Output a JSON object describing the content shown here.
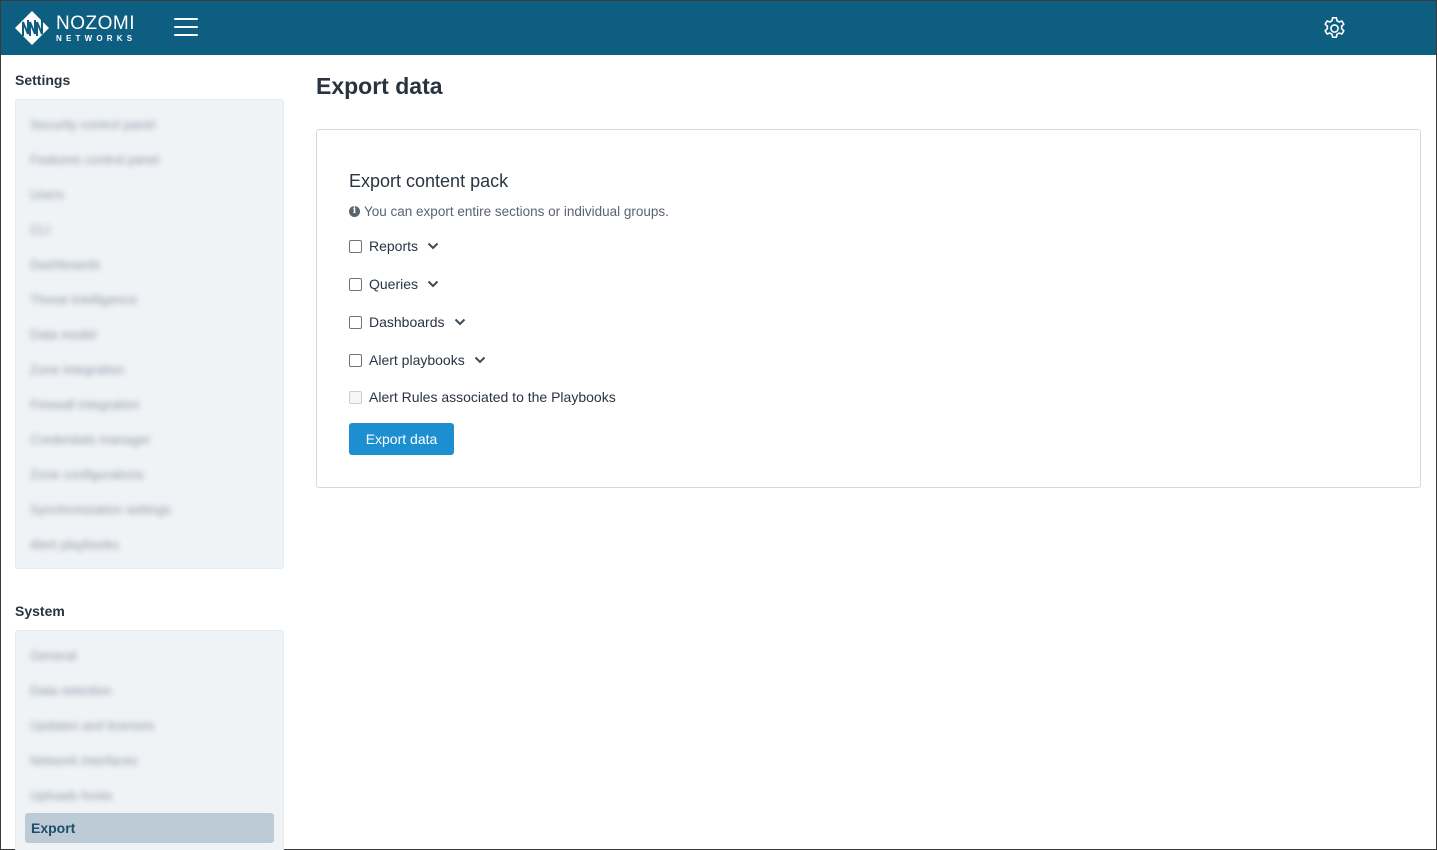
{
  "header": {
    "logo_word": "NOZOMI",
    "logo_sub": "NETWORKS",
    "menu_icon": "hamburger-icon",
    "settings_icon": "gear-icon",
    "bar_color": "#0e5e82"
  },
  "sidebar": {
    "settings_heading": "Settings",
    "settings_items": [
      "Security control panel",
      "Features control panel",
      "Users",
      "CLI",
      "Dashboards",
      "Threat Intelligence",
      "Data model",
      "Zone integration",
      "Firewall integration",
      "Credentials manager",
      "Zone configurations",
      "Synchronization settings",
      "Alert playbooks"
    ],
    "system_heading": "System",
    "system_items": [
      "General",
      "Data retention",
      "Updates and licenses",
      "Network interfaces",
      "Uploads hosts"
    ],
    "active_item": "Export"
  },
  "main": {
    "page_title": "Export data",
    "card_title": "Export content pack",
    "info_text": "You can export entire sections or individual groups.",
    "options": [
      {
        "label": "Reports",
        "checked": false,
        "expandable": true
      },
      {
        "label": "Queries",
        "checked": false,
        "expandable": true
      },
      {
        "label": "Dashboards",
        "checked": false,
        "expandable": true
      },
      {
        "label": "Alert playbooks",
        "checked": false,
        "expandable": true
      }
    ],
    "rules_option": {
      "label": "Alert Rules associated to the Playbooks",
      "checked": false,
      "disabled": true
    },
    "export_button": "Export data",
    "button_color": "#1d8fd1"
  }
}
